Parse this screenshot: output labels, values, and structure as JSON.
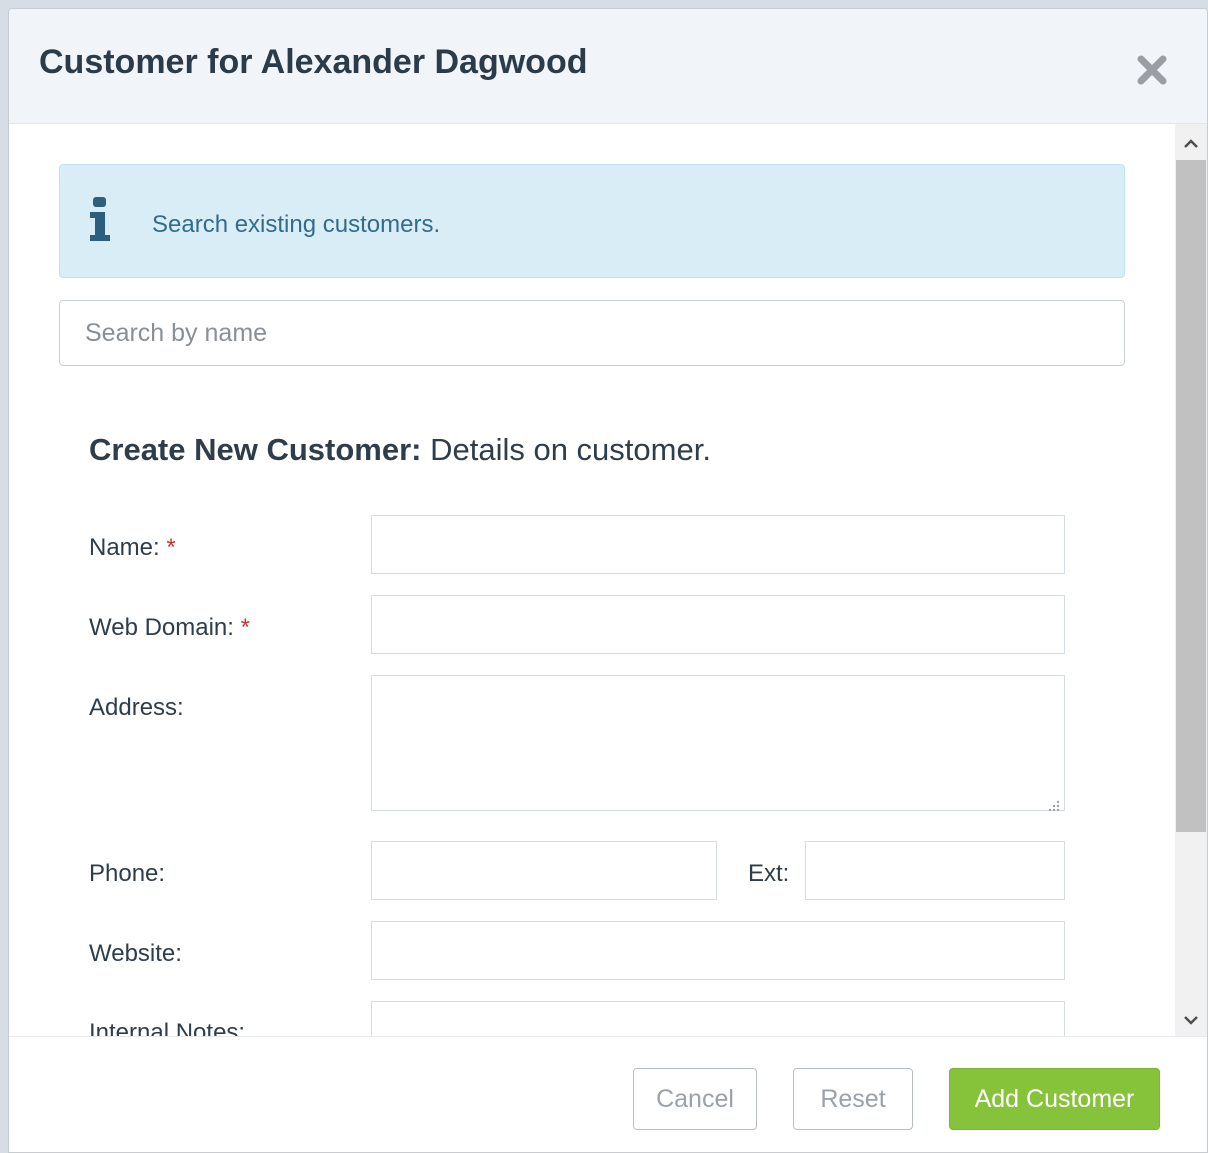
{
  "modal": {
    "title": "Customer for Alexander Dagwood",
    "close_icon": "close-icon"
  },
  "info": {
    "icon": "info-icon",
    "text": "Search existing customers."
  },
  "search": {
    "placeholder": "Search by name",
    "value": ""
  },
  "section": {
    "heading_strong": "Create New Customer:",
    "heading_rest": " Details on customer."
  },
  "form": {
    "name_label": "Name:",
    "web_domain_label": "Web Domain:",
    "address_label": "Address:",
    "phone_label": "Phone:",
    "ext_label": "Ext:",
    "website_label": "Website:",
    "internal_notes_label": "Internal Notes:",
    "required_marker": "*",
    "name_value": "",
    "web_domain_value": "",
    "address_value": "",
    "phone_value": "",
    "ext_value": "",
    "website_value": "",
    "internal_notes_value": ""
  },
  "footer": {
    "cancel_label": "Cancel",
    "reset_label": "Reset",
    "add_label": "Add Customer"
  },
  "colors": {
    "primary_button": "#86c33b",
    "info_background": "#d9edf7",
    "info_text": "#316c8d",
    "required": "#d0322d"
  }
}
